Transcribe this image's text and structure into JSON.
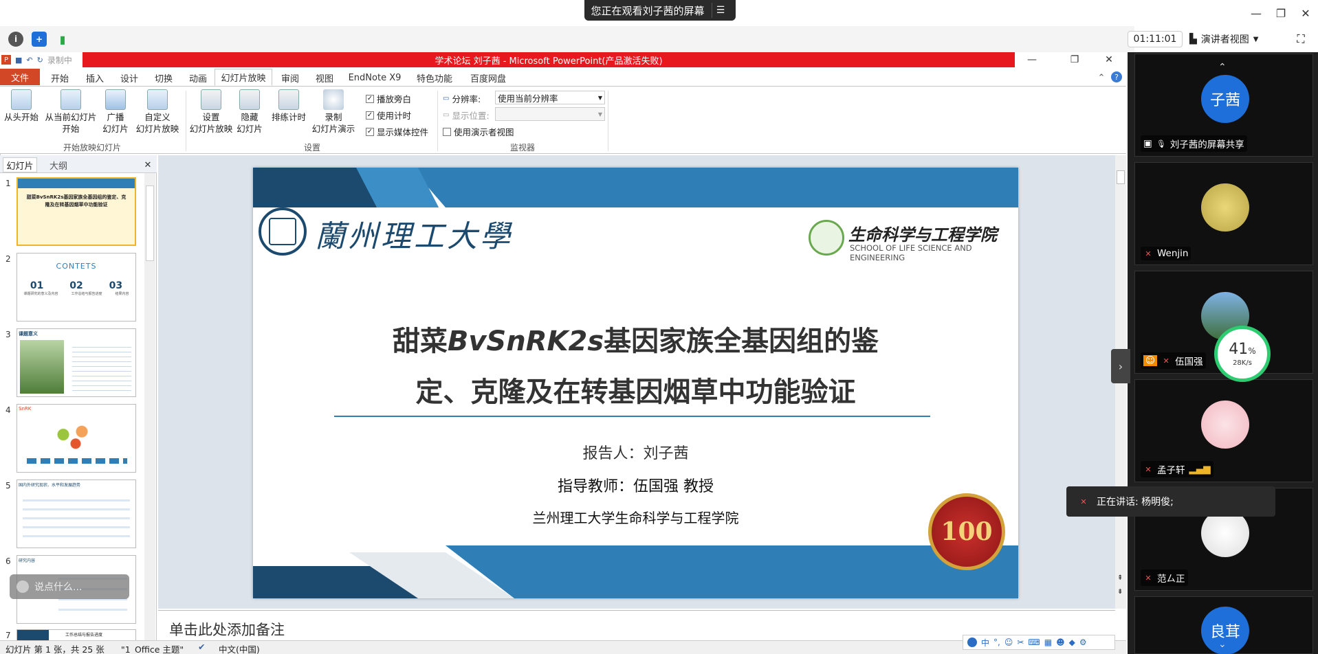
{
  "meeting": {
    "share_banner": "您正在观看刘子茜的屏幕",
    "timer": "01:11:01",
    "presenter_view": "演讲者视图"
  },
  "ppt": {
    "window_title": "学术论坛 刘子茜 - Microsoft PowerPoint(产品激活失败)",
    "recording_label": "录制中",
    "tabs": [
      "文件",
      "开始",
      "插入",
      "设计",
      "切换",
      "动画",
      "幻灯片放映",
      "审阅",
      "视图",
      "EndNote X9",
      "特色功能",
      "百度网盘"
    ],
    "active_tab": "幻灯片放映",
    "ribbon": {
      "start_group": {
        "from_start": "从头开始",
        "from_current_1": "从当前幻灯片",
        "from_current_2": "开始",
        "broadcast_1": "广播",
        "broadcast_2": "幻灯片",
        "custom_1": "自定义",
        "custom_2": "幻灯片放映",
        "label": "开始放映幻灯片"
      },
      "setup_group": {
        "setup_1": "设置",
        "setup_2": "幻灯片放映",
        "hide_1": "隐藏",
        "hide_2": "幻灯片",
        "rehearse": "排练计时",
        "record_1": "录制",
        "record_2": "幻灯片演示",
        "play_narration": "播放旁白",
        "use_timings": "使用计时",
        "show_media": "显示媒体控件",
        "label": "设置"
      },
      "monitor_group": {
        "resolution_label": "分辨率:",
        "resolution_value": "使用当前分辨率",
        "show_on_label": "显示位置:",
        "presenter_view_chk": "使用演示者视图",
        "label": "监视器"
      }
    },
    "left_tabs": [
      "幻灯片",
      "大纲"
    ],
    "thumbs": [
      {
        "num": "1",
        "text": "甜菜BvSnRK2s基因家族全基因组的鉴定、克隆及在转基因烟草中功能验证"
      },
      {
        "num": "2",
        "text": "CONTETS",
        "items": [
          {
            "n": "01",
            "t": "课题研究的意义及内容"
          },
          {
            "n": "02",
            "t": "工作总结与报告进度"
          },
          {
            "n": "03",
            "t": "结果内容"
          }
        ]
      },
      {
        "num": "3",
        "text": "课题意义"
      },
      {
        "num": "4",
        "text": "SnRK"
      },
      {
        "num": "5",
        "text": "国内外研究现状、水平和发展趋势"
      },
      {
        "num": "6",
        "text": "研究内容"
      },
      {
        "num": "7",
        "text": "工作总结与报告进度"
      }
    ],
    "slide": {
      "university": "蘭州理工大學",
      "school_cn": "生命科学与工程学院",
      "school_en": "SCHOOL OF LIFE SCIENCE AND ENGINEERING",
      "title_pre": "甜菜",
      "title_gene": "BvSnRK2s",
      "title_post": "基因家族全基因组的鉴",
      "title_line2": "定、克隆及在转基因烟草中功能验证",
      "reporter": "报告人：刘子茜",
      "advisor": "指导教师：伍国强 教授",
      "institution": "兰州理工大学生命科学与工程学院",
      "badge_text": "100"
    },
    "notes_placeholder": "单击此处添加备注",
    "status": {
      "slide_info": "幻灯片 第 1 张，共 25 张",
      "theme": "\"1_Office 主题\"",
      "language": "中文(中国)"
    },
    "chat_placeholder": "说点什么..."
  },
  "participants": [
    {
      "name": "刘子茜的屏幕共享",
      "avatar": "子茜"
    },
    {
      "name": "Wenjin"
    },
    {
      "name": "伍国强"
    },
    {
      "name": "孟子轩"
    },
    {
      "name": "范ㄙ正"
    },
    {
      "avatar": "良茸"
    }
  ],
  "speaking": "正在讲话: 杨明俊;",
  "network": {
    "percent": "41",
    "unit": "%",
    "speed": "28K/s"
  },
  "colors": {
    "accent": "#2f7fb6",
    "ppt_red": "#e8191e",
    "file_tab": "#d24726",
    "navy": "#1c4a6e"
  }
}
